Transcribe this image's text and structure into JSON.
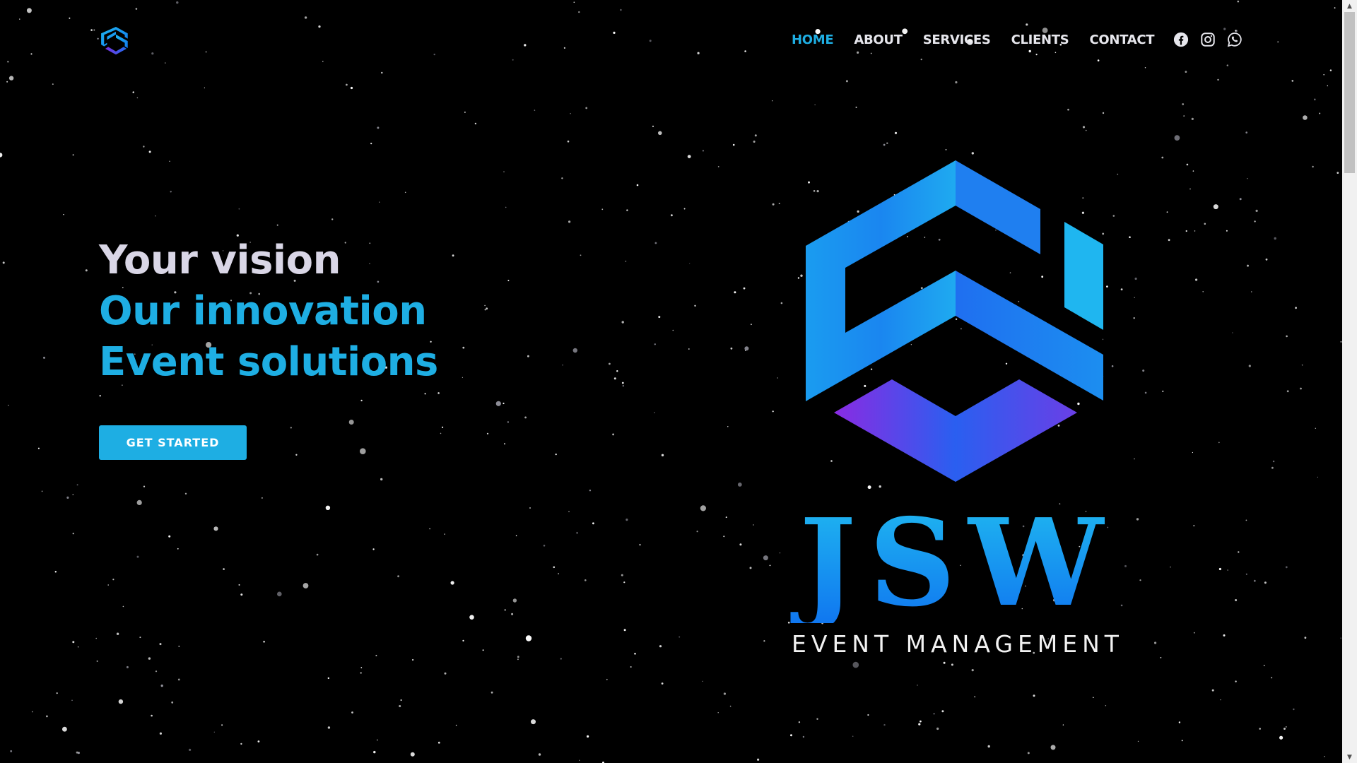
{
  "header": {
    "logo_icon": "jsw-hexagon-logo-icon",
    "nav": [
      {
        "label": "HOME",
        "active": true
      },
      {
        "label": "ABOUT",
        "active": false
      },
      {
        "label": "SERVICES",
        "active": false
      },
      {
        "label": "CLIENTS",
        "active": false
      },
      {
        "label": "CONTACT",
        "active": false
      }
    ],
    "socials": [
      "facebook-icon",
      "instagram-icon",
      "whatsapp-icon"
    ]
  },
  "hero": {
    "line1": "Your vision",
    "line2": "Our innovation",
    "line3": "Event solutions",
    "cta_label": "GET STARTED"
  },
  "brand": {
    "name": "JSW",
    "subtitle": "EVENT MANAGEMENT"
  },
  "colors": {
    "accent": "#1eaee3",
    "hero_text": "#d9d6e6",
    "background": "#000000",
    "logo_blue": "#1a8cf0",
    "logo_purple": "#7b2fe0"
  }
}
